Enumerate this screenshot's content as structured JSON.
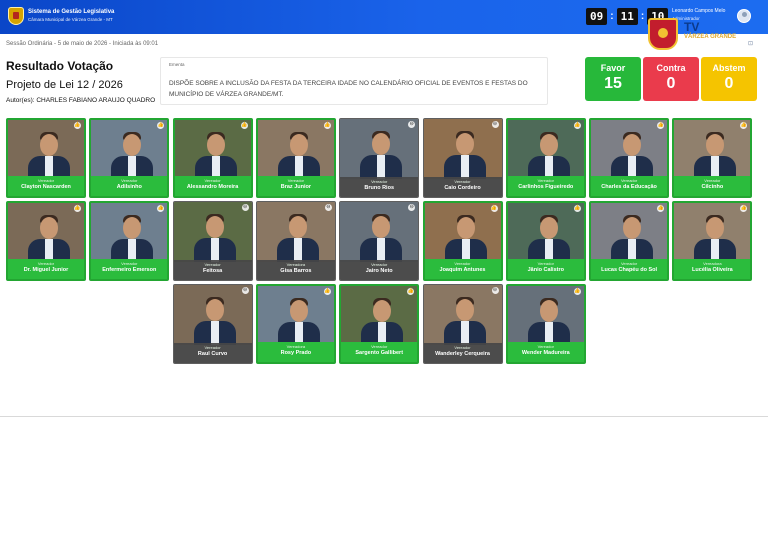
{
  "header": {
    "system_title": "Sistema de Gestão Legislativa",
    "system_subtitle": "Câmara Municipal de Várzea Grande - MT",
    "clock": {
      "hh": "09",
      "mm": "11",
      "ss": "10"
    },
    "user": {
      "name": "Leonardo Campos Melo",
      "role": "Administrador"
    },
    "tv_brand": "TV",
    "tv_subtitle": "VÁRZEA GRANDE"
  },
  "session_line": "Sessão Ordinária - 5 de maio de 2026 - Iniciada às 09:01",
  "result_title": "Resultado Votação",
  "project_title": "Projeto de Lei 12 / 2026",
  "authors": "Autor(es): CHARLES FABIANO ARAUJO QUADRO",
  "ementa": {
    "label": "Ementa",
    "text": "DISPÕE SOBRE A INCLUSÃO DA FESTA DA TERCEIRA IDADE NO CALENDÁRIO OFICIAL DE EVENTOS E FESTAS DO MUNICÍPIO DE VÁRZEA GRANDE/MT."
  },
  "tally": {
    "favor": {
      "label": "Favor",
      "value": "15",
      "color": "#27b83a"
    },
    "contra": {
      "label": "Contra",
      "value": "0",
      "color": "#ea3b4c"
    },
    "abstem": {
      "label": "Abstem",
      "value": "0",
      "color": "#f5c400"
    }
  },
  "councilors": [
    {
      "role": "Vereador",
      "name": "Clayton Nascarden",
      "vote": "favor"
    },
    {
      "role": "Vereador",
      "name": "Adilsinho",
      "vote": "favor"
    },
    {
      "role": "Vereador",
      "name": "Alessandro Moreira",
      "vote": "favor"
    },
    {
      "role": "Vereador",
      "name": "Braz Junior",
      "vote": "favor"
    },
    {
      "role": "Vereador",
      "name": "Bruno Rios",
      "vote": "none"
    },
    {
      "role": "Vereador",
      "name": "Caio Cordeiro",
      "vote": "none"
    },
    {
      "role": "Vereador",
      "name": "Carlinhos Figueiredo",
      "vote": "favor"
    },
    {
      "role": "Vereador",
      "name": "Charles da Educação",
      "vote": "favor"
    },
    {
      "role": "Vereador",
      "name": "Cilcinho",
      "vote": "favor"
    },
    {
      "role": "Vereador",
      "name": "Dr. Miguel Junior",
      "vote": "favor"
    },
    {
      "role": "Vereador",
      "name": "Enfermeiro Emerson",
      "vote": "favor"
    },
    {
      "role": "Vereador",
      "name": "Feitosa",
      "vote": "none"
    },
    {
      "role": "Vereadora",
      "name": "Gisa Barros",
      "vote": "none"
    },
    {
      "role": "Vereador",
      "name": "Jairo Neto",
      "vote": "none"
    },
    {
      "role": "Vereador",
      "name": "Joaquim Antunes",
      "vote": "favor"
    },
    {
      "role": "Vereador",
      "name": "Jânio Calistro",
      "vote": "favor"
    },
    {
      "role": "Vereador",
      "name": "Lucas Chapéu do Sol",
      "vote": "favor"
    },
    {
      "role": "Vereadora",
      "name": "Lucélia Oliveira",
      "vote": "favor"
    },
    {
      "role": "Vereador",
      "name": "Raul Curvo",
      "vote": "none"
    },
    {
      "role": "Vereadora",
      "name": "Rosy Prado",
      "vote": "favor"
    },
    {
      "role": "Vereador",
      "name": "Sargento Gallibert",
      "vote": "favor"
    },
    {
      "role": "Vereador",
      "name": "Wanderley Cerqueira",
      "vote": "none"
    },
    {
      "role": "Vereador",
      "name": "Wender Madureira",
      "vote": "favor"
    }
  ]
}
